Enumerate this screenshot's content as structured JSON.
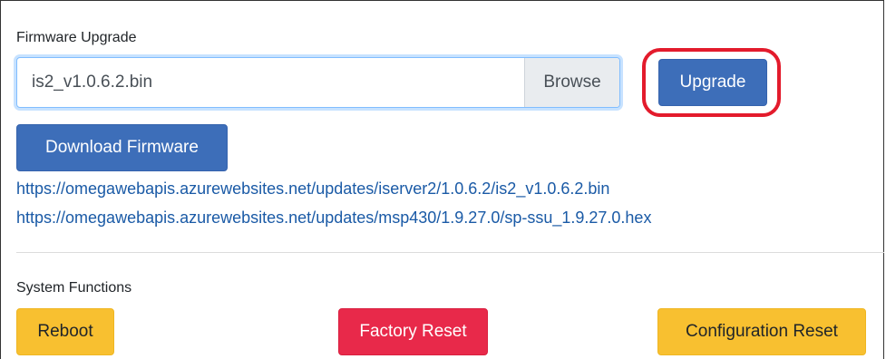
{
  "firmware": {
    "section_label": "Firmware Upgrade",
    "file_value": "is2_v1.0.6.2.bin",
    "browse_label": "Browse",
    "upgrade_label": "Upgrade",
    "download_label": "Download Firmware",
    "links": [
      "https://omegawebapis.azurewebsites.net/updates/iserver2/1.0.6.2/is2_v1.0.6.2.bin",
      "https://omegawebapis.azurewebsites.net/updates/msp430/1.9.27.0/sp-ssu_1.9.27.0.hex"
    ]
  },
  "system": {
    "section_label": "System Functions",
    "reboot_label": "Reboot",
    "factory_reset_label": "Factory Reset",
    "config_reset_label": "Configuration Reset"
  },
  "colors": {
    "primary": "#3d6eb9",
    "warning": "#f8c030",
    "danger": "#e8294a",
    "highlight": "#e31b2c",
    "link": "#1a5aa6"
  }
}
